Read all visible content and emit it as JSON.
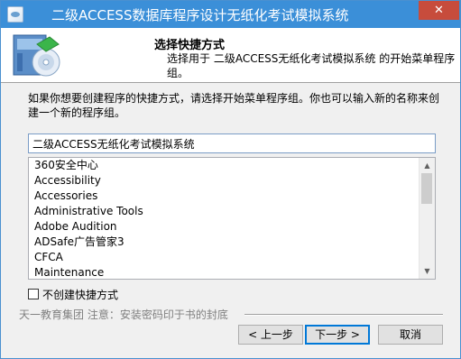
{
  "window": {
    "title": "二级ACCESS数据库程序设计无纸化考试模拟系统",
    "close_glyph": "✕"
  },
  "header": {
    "title": "选择快捷方式",
    "subtitle": "选择用于 二级ACCESS无纸化考试模拟系统 的开始菜单程序组。"
  },
  "body": {
    "description": "如果你想要创建程序的快捷方式，请选择开始菜单程序组。你也可以输入新的名称来创建一个新的程序组。",
    "folder_input_value": "二级ACCESS无纸化考试模拟系统",
    "folders": [
      "360安全中心",
      "Accessibility",
      "Accessories",
      "Administrative Tools",
      "Adobe Audition",
      "ADSafe广告管家3",
      "CFCA",
      "Maintenance"
    ],
    "no_shortcut_label": "不创建快捷方式",
    "no_shortcut_checked": false
  },
  "footer": {
    "brand_text": "天一教育集团    注意：安装密码印于书的封底"
  },
  "buttons": {
    "back": "< 上一步",
    "next": "下一步 >",
    "cancel": "取消"
  },
  "icons": {
    "scroll_up": "▲",
    "scroll_down": "▼"
  }
}
